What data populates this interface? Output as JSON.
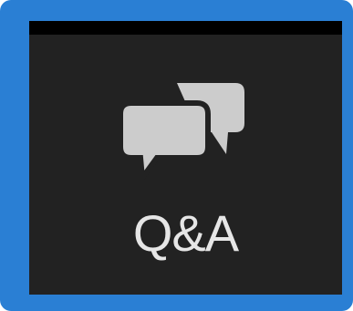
{
  "button": {
    "label": "Q&A",
    "icon": "chat-bubbles-icon"
  },
  "colors": {
    "frame": "#2a7fd4",
    "face": "#222222",
    "icon": "#cccccc",
    "label": "#e6e6e6"
  }
}
